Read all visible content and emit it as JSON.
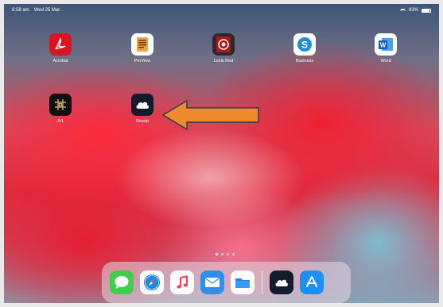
{
  "status_bar": {
    "time": "8:58 am",
    "date": "Wed 25 Mar",
    "battery": "83%"
  },
  "home_screen": {
    "apps": [
      {
        "label": "Acrobat",
        "icon": "acrobat-icon"
      },
      {
        "label": "ProView",
        "icon": "proview-icon"
      },
      {
        "label": "Lexis Red",
        "icon": "lexis-red-icon"
      },
      {
        "label": "Business",
        "icon": "skype-business-icon"
      },
      {
        "label": "Word",
        "icon": "word-icon"
      },
      {
        "label": "JVL",
        "icon": "jvl-icon"
      },
      {
        "label": "Resop",
        "icon": "resop-cloud-icon"
      }
    ],
    "page_count": 4,
    "current_page": 1
  },
  "dock": {
    "apps": [
      "messages-icon",
      "safari-icon",
      "music-icon",
      "mail-icon",
      "files-icon",
      "resop-cloud-icon",
      "app-store-icon"
    ]
  },
  "annotation": {
    "arrow_color": "#f08a2c",
    "points_to": "Resop"
  }
}
